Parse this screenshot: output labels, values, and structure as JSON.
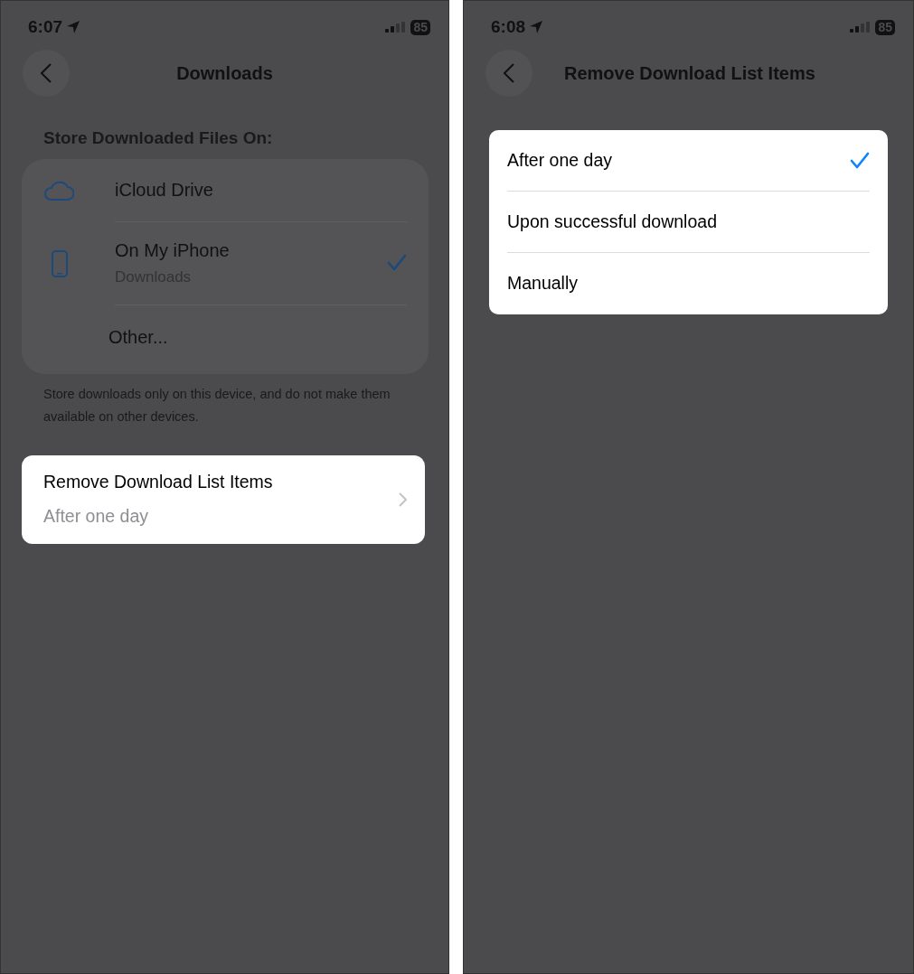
{
  "left_screen": {
    "status_bar": {
      "time": "6:07",
      "battery": "85"
    },
    "nav": {
      "title": "Downloads"
    },
    "section_header": "Store Downloaded Files On:",
    "locations": [
      {
        "kind": "cloud",
        "label": "iCloud Drive",
        "selected": false
      },
      {
        "kind": "phone",
        "label": "On My iPhone",
        "sublabel": "Downloads",
        "selected": true
      },
      {
        "kind": "plain",
        "label": "Other...",
        "selected": false
      }
    ],
    "footer": "Store downloads only on this device, and do not make them available on other devices.",
    "setting": {
      "label": "Remove Download List Items",
      "value": "After one day",
      "highlighted": true
    }
  },
  "right_screen": {
    "status_bar": {
      "time": "6:08",
      "battery": "85"
    },
    "nav": {
      "title": "Remove Download List Items"
    },
    "highlighted": true,
    "options": [
      {
        "label": "After one day",
        "selected": true
      },
      {
        "label": "Upon successful download",
        "selected": false
      },
      {
        "label": "Manually",
        "selected": false
      }
    ]
  }
}
